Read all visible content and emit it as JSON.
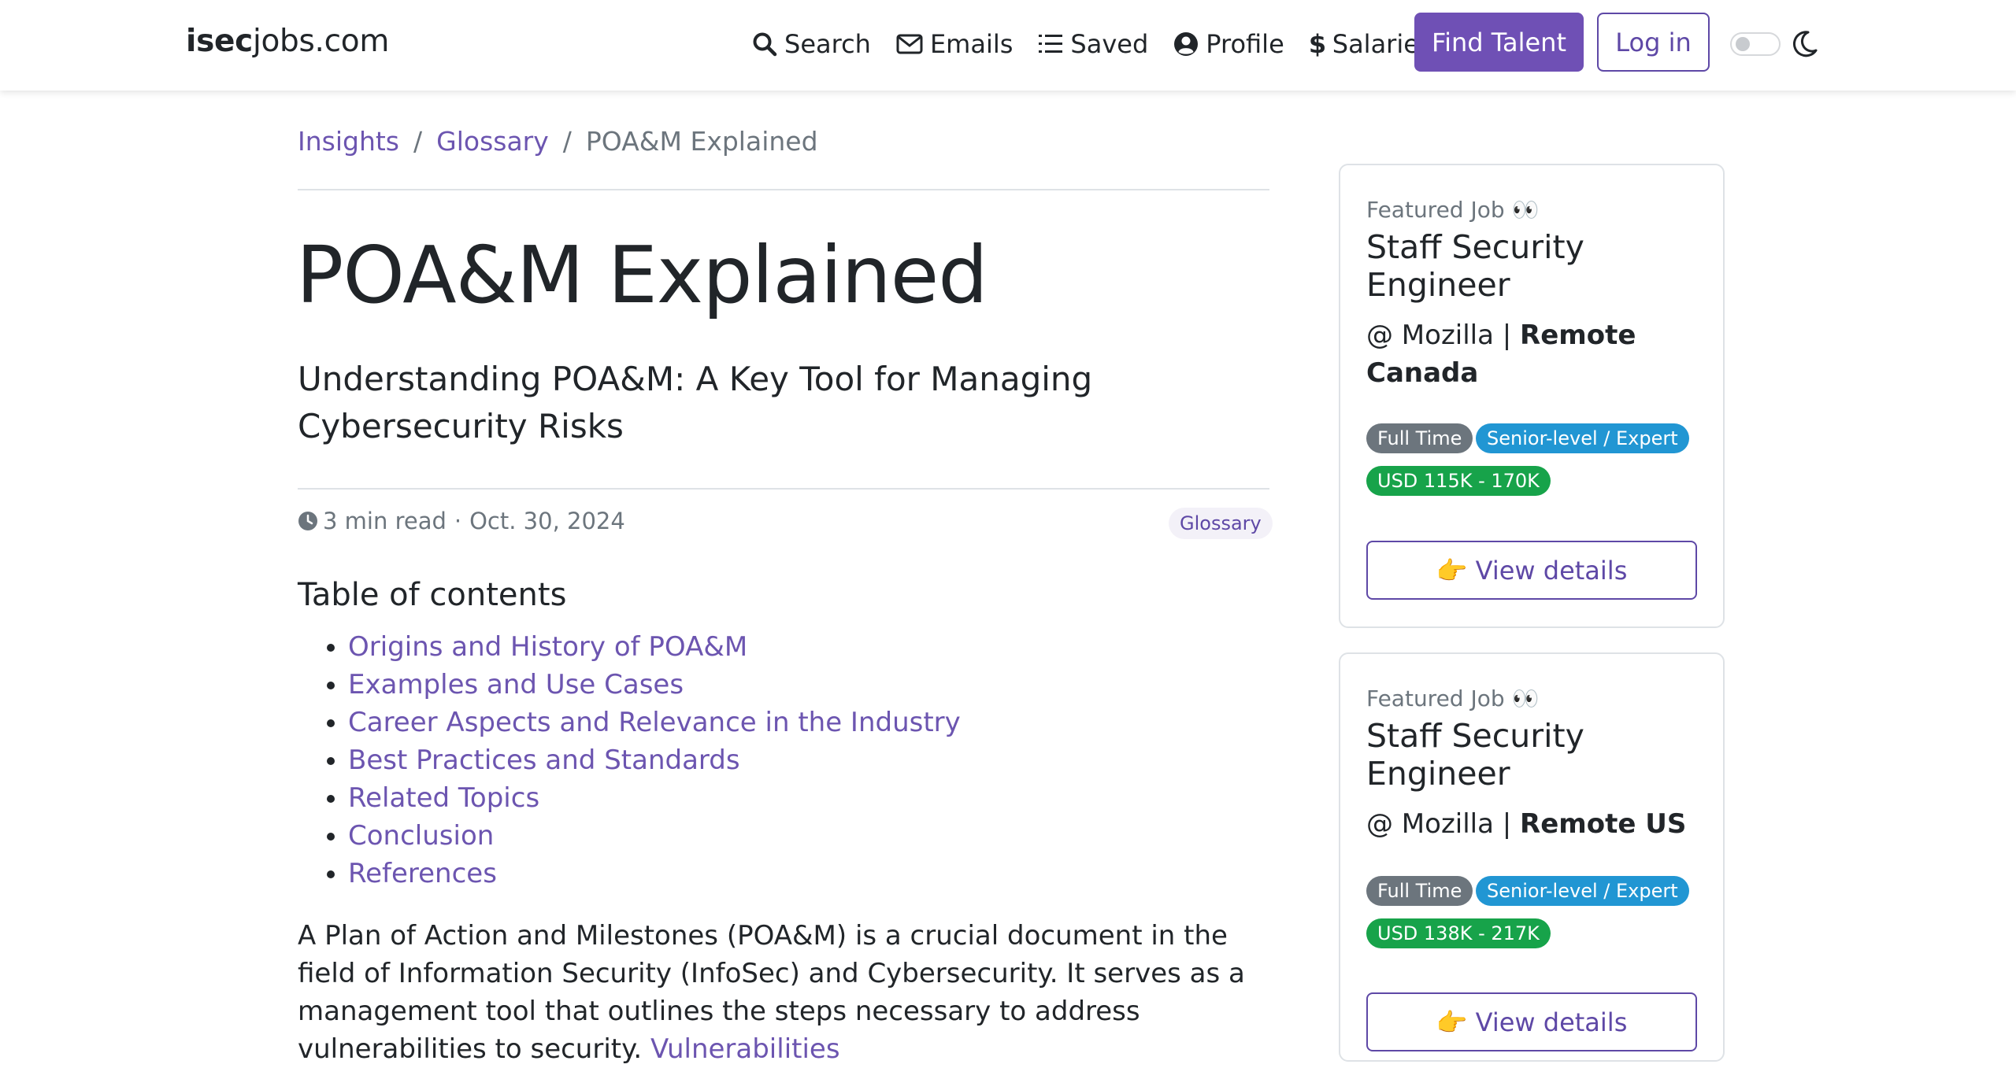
{
  "navbar": {
    "brand_bold": "isec",
    "brand_rest": "jobs.com",
    "links": {
      "search": "Search",
      "emails": "Emails",
      "saved": "Saved",
      "profile": "Profile",
      "salaries": "Salaries"
    },
    "find_talent": "Find Talent",
    "login": "Log in"
  },
  "breadcrumb": {
    "insights": "Insights",
    "glossary": "Glossary",
    "current": "POA&M Explained",
    "separator": "/"
  },
  "article": {
    "title": "POA&M Explained",
    "subtitle": "Understanding POA&M: A Key Tool for Managing Cybersecurity Risks",
    "read_time": "3 min read",
    "dot": "·",
    "date": "Oct. 30, 2024",
    "tag": "Glossary",
    "toc_heading": "Table of contents",
    "toc": [
      "Origins and History of POA&M",
      "Examples and Use Cases",
      "Career Aspects and Relevance in the Industry",
      "Best Practices and Standards",
      "Related Topics",
      "Conclusion",
      "References"
    ],
    "intro_text": "A Plan of Action and Milestones (POA&M) is a crucial document in the field of Information Security (InfoSec) and Cybersecurity. It serves as a management tool that outlines the steps necessary to address vulnerabilities to security. ",
    "intro_link": "Vulnerabilities"
  },
  "sidebar": {
    "cards": [
      {
        "featured": "Featured Job 👀",
        "title": "Staff Security Engineer",
        "company_prefix": "@ Mozilla | ",
        "location": "Remote Canada",
        "badges": [
          "Full Time",
          "Senior-level / Expert",
          "USD 115K - 170K"
        ],
        "button": "👉 View details"
      },
      {
        "featured": "Featured Job 👀",
        "title": "Staff Security Engineer",
        "company_prefix": "@ Mozilla | ",
        "location": "Remote US",
        "badges": [
          "Full Time",
          "Senior-level / Expert",
          "USD 138K - 217K"
        ],
        "button": "👉 View details"
      }
    ]
  },
  "colors": {
    "brand_purple": "#6f50b5",
    "link_purple": "#6c55b0",
    "badge_grey": "#6c757d",
    "badge_blue": "#2196d3",
    "badge_green": "#17a34a"
  }
}
